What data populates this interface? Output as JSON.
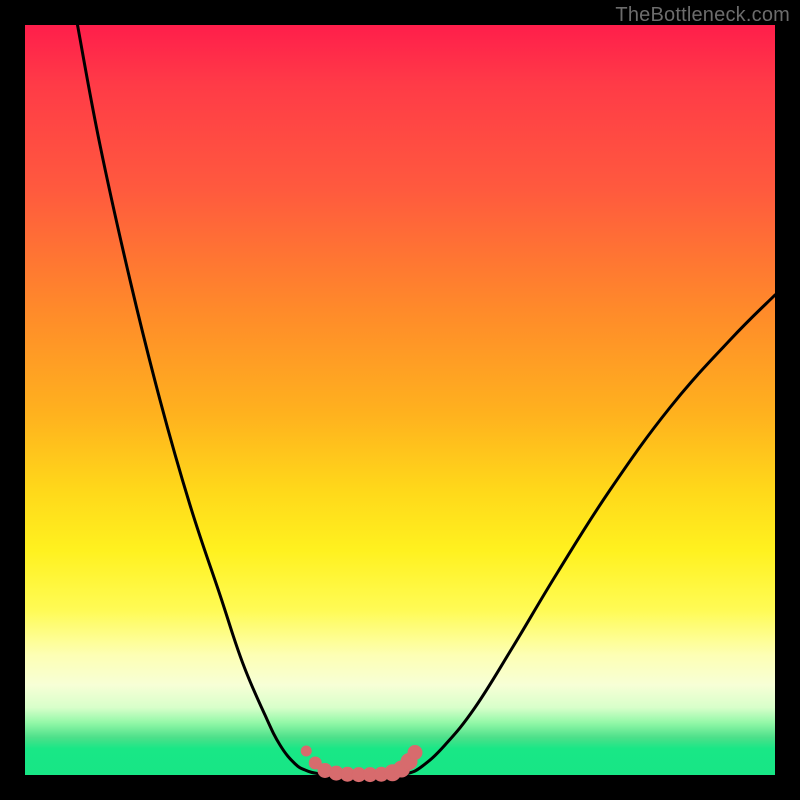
{
  "watermark": {
    "text": "TheBottleneck.com"
  },
  "colors": {
    "curve_stroke": "#000000",
    "marker_fill": "#d76b6d",
    "marker_stroke": "#d76b6d"
  },
  "chart_data": {
    "type": "line",
    "title": "",
    "xlabel": "",
    "ylabel": "",
    "xlim": [
      0,
      100
    ],
    "ylim": [
      0,
      100
    ],
    "series": [
      {
        "name": "left-branch",
        "x": [
          7,
          10,
          14,
          18,
          22,
          26,
          29,
          32,
          34,
          36,
          37.5,
          39
        ],
        "y": [
          100,
          84,
          66,
          50,
          36,
          24,
          15,
          8,
          4,
          1.5,
          0.6,
          0.2
        ]
      },
      {
        "name": "valley-floor",
        "x": [
          39,
          41,
          43,
          45,
          47,
          49,
          51
        ],
        "y": [
          0.2,
          0.05,
          0,
          0,
          0,
          0.05,
          0.2
        ]
      },
      {
        "name": "right-branch",
        "x": [
          51,
          53,
          56,
          60,
          65,
          71,
          78,
          86,
          94,
          100
        ],
        "y": [
          0.2,
          1.2,
          4,
          9,
          17,
          27,
          38,
          49,
          58,
          64
        ]
      }
    ],
    "markers": {
      "name": "valley-markers",
      "points": [
        {
          "x": 37.5,
          "y": 3.2,
          "r": 5
        },
        {
          "x": 38.7,
          "y": 1.6,
          "r": 6
        },
        {
          "x": 40.0,
          "y": 0.6,
          "r": 7
        },
        {
          "x": 41.5,
          "y": 0.25,
          "r": 7
        },
        {
          "x": 43.0,
          "y": 0.1,
          "r": 7
        },
        {
          "x": 44.5,
          "y": 0.05,
          "r": 7
        },
        {
          "x": 46.0,
          "y": 0.05,
          "r": 7
        },
        {
          "x": 47.5,
          "y": 0.1,
          "r": 7
        },
        {
          "x": 49.0,
          "y": 0.3,
          "r": 8
        },
        {
          "x": 50.2,
          "y": 0.8,
          "r": 8
        },
        {
          "x": 51.2,
          "y": 1.8,
          "r": 8
        },
        {
          "x": 52.0,
          "y": 3.0,
          "r": 7
        }
      ]
    }
  }
}
